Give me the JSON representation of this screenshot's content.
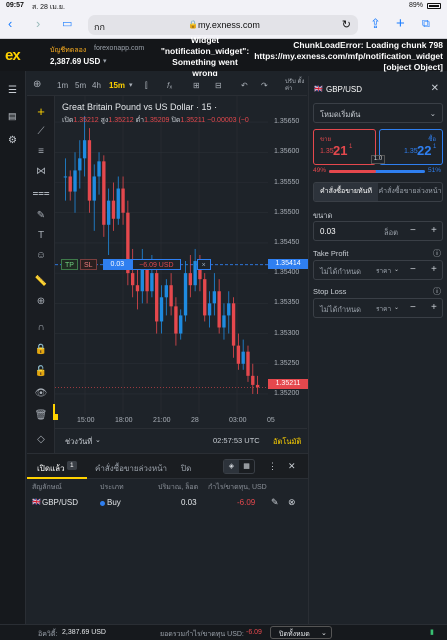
{
  "status": {
    "time": "09:57",
    "date": "ส. 28 เม.ย.",
    "battery": "89%"
  },
  "browser": {
    "aa": "กก",
    "url": "my.exness.com"
  },
  "header": {
    "account_type": "บัญชีทดลอง",
    "account_server": "forexonapp.com",
    "balance": "2,387.69 USD",
    "error_widget": [
      "Widget",
      "\"notification_widget\":",
      "Something went",
      "wrong"
    ],
    "error_chunk": [
      "ChunkLoadError: Loading chunk 798",
      "https://my.exness.com/mfp/notification_widget",
      "[object Object]"
    ]
  },
  "chart_toolbar": {
    "timeframes": [
      "1m",
      "5m",
      "4h",
      "15m"
    ],
    "active": "15m",
    "right_label": "ปรับ\nตั้งค่า"
  },
  "chart": {
    "title": "Great Britain Pound vs US Dollar · 15 ·",
    "ohlc": {
      "o_label": "เปิด",
      "o": "1.35212",
      "h_label": "สูง",
      "h": "1.35212",
      "l_label": "ต่ำ",
      "l": "1.35209",
      "c_label": "ปิด",
      "c": "1.35211",
      "chg": "−0.00003 (−0"
    },
    "position_line": {
      "tp": "TP",
      "sl": "SL",
      "volume": "0.03",
      "pl": "−6.09 USD",
      "close": "×",
      "price": "1.35414"
    },
    "last_price": "1.35211",
    "price_ticks": [
      "1.35650",
      "1.35600",
      "1.35550",
      "1.35500",
      "1.35450",
      "1.35400",
      "1.35350",
      "1.35300",
      "1.35250",
      "1.35200"
    ],
    "time_ticks": [
      "15:00",
      "18:00",
      "21:00",
      "28",
      "03:00",
      "05"
    ],
    "range_label": "ช่วงวันที่",
    "clock": "02:57:53 UTC",
    "auto": "อัตโนมัติ"
  },
  "chart_data": {
    "type": "candlestick",
    "title": "Great Britain Pound vs US Dollar · 15 ·",
    "ylim": [
      1.3519,
      1.3567
    ],
    "yticks": [
      1.3565,
      1.356,
      1.3555,
      1.355,
      1.3545,
      1.354,
      1.3535,
      1.353,
      1.3525,
      1.352
    ],
    "xticks": [
      "15:00",
      "18:00",
      "21:00",
      "28",
      "03:00",
      "05"
    ],
    "candles": [
      [
        1.3556,
        1.3559,
        1.3552,
        1.3556
      ],
      [
        1.3556,
        1.3557,
        1.3552,
        1.35535
      ],
      [
        1.35535,
        1.356,
        1.355,
        1.3557
      ],
      [
        1.3557,
        1.3562,
        1.3554,
        1.3559
      ],
      [
        1.3559,
        1.3566,
        1.3556,
        1.3562
      ],
      [
        1.3562,
        1.3564,
        1.355,
        1.3552
      ],
      [
        1.3552,
        1.3558,
        1.3547,
        1.3556
      ],
      [
        1.3556,
        1.356,
        1.3553,
        1.35585
      ],
      [
        1.35585,
        1.35595,
        1.3546,
        1.3548
      ],
      [
        1.3548,
        1.3554,
        1.3543,
        1.3552
      ],
      [
        1.3552,
        1.3555,
        1.3547,
        1.3549
      ],
      [
        1.3549,
        1.3556,
        1.3548,
        1.3554
      ],
      [
        1.3554,
        1.3556,
        1.3548,
        1.355
      ],
      [
        1.355,
        1.3552,
        1.3538,
        1.354
      ],
      [
        1.354,
        1.3544,
        1.3536,
        1.3538
      ],
      [
        1.3538,
        1.3542,
        1.3534,
        1.3537
      ],
      [
        1.3537,
        1.3544,
        1.3535,
        1.3541
      ],
      [
        1.3541,
        1.3542,
        1.3535,
        1.3537
      ],
      [
        1.3537,
        1.3543,
        1.3536,
        1.354
      ],
      [
        1.354,
        1.3541,
        1.353,
        1.3532
      ],
      [
        1.3532,
        1.3538,
        1.353,
        1.3536
      ],
      [
        1.3536,
        1.3539,
        1.3533,
        1.3538
      ],
      [
        1.3538,
        1.354,
        1.3533,
        1.35345
      ],
      [
        1.35345,
        1.3536,
        1.3528,
        1.353
      ],
      [
        1.353,
        1.3534,
        1.3529,
        1.3533
      ],
      [
        1.3533,
        1.3542,
        1.3532,
        1.354
      ],
      [
        1.354,
        1.3543,
        1.3536,
        1.3538
      ],
      [
        1.3538,
        1.3544,
        1.3537,
        1.3542
      ],
      [
        1.3542,
        1.3543,
        1.3537,
        1.3539
      ],
      [
        1.3539,
        1.354,
        1.3532,
        1.3533
      ],
      [
        1.3533,
        1.3537,
        1.3531,
        1.3535
      ],
      [
        1.3535,
        1.354,
        1.3533,
        1.3537
      ],
      [
        1.3537,
        1.3539,
        1.353,
        1.3531
      ],
      [
        1.3531,
        1.3535,
        1.3529,
        1.3533
      ],
      [
        1.3533,
        1.3537,
        1.353,
        1.3535
      ],
      [
        1.3535,
        1.3536,
        1.3526,
        1.3528
      ],
      [
        1.3528,
        1.353,
        1.3524,
        1.3525
      ],
      [
        1.3525,
        1.3529,
        1.3524,
        1.3527
      ],
      [
        1.3527,
        1.3528,
        1.3522,
        1.3523
      ],
      [
        1.3523,
        1.3525,
        1.352,
        1.35215
      ],
      [
        1.35215,
        1.3523,
        1.352,
        1.35211
      ]
    ],
    "grid": true
  },
  "order_panel": {
    "symbol": "GBP/USD",
    "mode": "โหมดเริ่มต้น",
    "sell_label": "ขาย",
    "sell_price_main": "1.35",
    "sell_price_big": "21",
    "sell_price_sup": "1",
    "buy_label": "ซื้อ",
    "buy_price_main": "1.35",
    "buy_price_big": "22",
    "buy_price_sup": "1",
    "spread": "1.0",
    "sentiment_sell": "49%",
    "sentiment_sell_value": 49,
    "sentiment_buy": "51%",
    "tab_market": "คำสั่งซื้อขายทันที",
    "tab_pending": "คำสั่งซื้อขายล่วงหน้า",
    "volume_label": "ขนาด",
    "volume": "0.03",
    "volume_unit": "ล็อต",
    "tp_label": "Take Profit",
    "tp_value": "ไม่ได้กำหนด",
    "tp_unit": "ราคา",
    "sl_label": "Stop Loss",
    "sl_value": "ไม่ได้กำหนด",
    "sl_unit": "ราคา"
  },
  "positions": {
    "tab_open": "เปิดแล้ว",
    "open_count": "1",
    "tab_pending": "คำสั่งซื้อขายล่วงหน้า",
    "tab_closed": "ปิด",
    "headers": {
      "symbol": "สัญลักษณ์",
      "type": "ประเภท",
      "volume": "ปริมาณ, ล็อต",
      "pl": "กำไร/ขาดทุน, USD"
    },
    "rows": [
      {
        "symbol": "GBP/USD",
        "type": "Buy",
        "volume": "0.03",
        "pl": "-6.09"
      }
    ]
  },
  "footer": {
    "equity_label": "อิควิตี้:",
    "equity": "2,387.69 USD",
    "total_pl_label": "ยอดรวมกำไร/ขาดทุน USD:",
    "total_pl": "-6.09",
    "close_all": "ปิดทั้งหมด"
  },
  "colors": {
    "bull": "#1f8be0",
    "bear": "#e5484d",
    "accent": "#ffd200",
    "blue_line": "#2f7ff0"
  }
}
